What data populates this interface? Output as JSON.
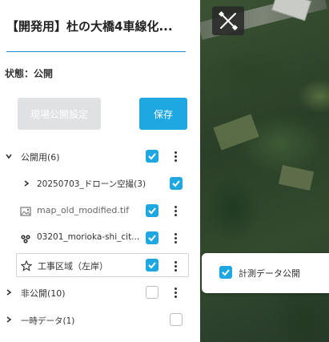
{
  "header": {
    "title": "【開発用】杜の大橋4車線化...",
    "status": "状態：公開"
  },
  "actions": {
    "publish_settings_label": "現場公開設定",
    "save_label": "保存"
  },
  "layers": {
    "public_group": "公開用(6)",
    "drone_folder": "20250703_ドローン空撮(3)",
    "map_file": "map_old_modified.tif",
    "morioka_file": "03201_morioka-shi_cit...",
    "construction_area": "工事区域（左岸）",
    "private_group": "非公開(10)",
    "temp_group": "一時データ(1)"
  },
  "popup": {
    "measurement_public_label": "計測データ公開"
  },
  "colors": {
    "accent": "#1ea7e1",
    "title_line": "#1a8bd0",
    "disabled_button": "#dfe1e3"
  }
}
